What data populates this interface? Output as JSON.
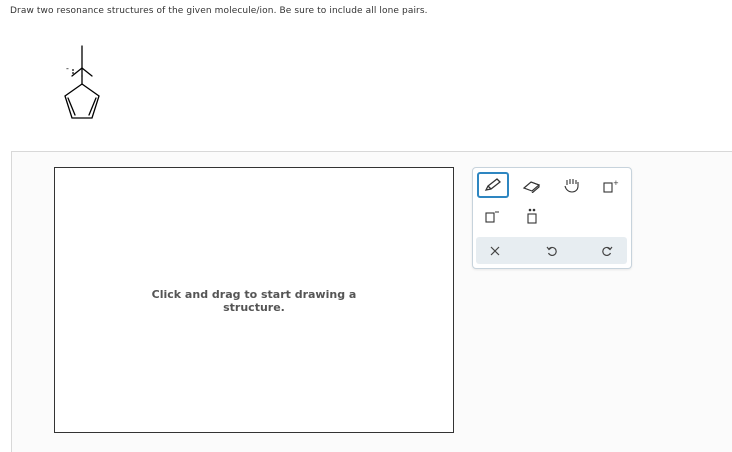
{
  "question": {
    "text": "Draw two resonance structures of the given molecule/ion. Be sure to include all lone pairs."
  },
  "canvas": {
    "hint_line1": "Click and drag to start drawing a",
    "hint_line2": "structure."
  },
  "toolbar": {
    "tools": [
      "pencil-icon",
      "eraser-icon",
      "hand-icon",
      "positive-charge-icon",
      "negative-charge-icon",
      "lone-pair-icon"
    ],
    "actions": [
      "clear-icon",
      "undo-icon",
      "redo-icon"
    ],
    "accent": "#2e86c1"
  }
}
